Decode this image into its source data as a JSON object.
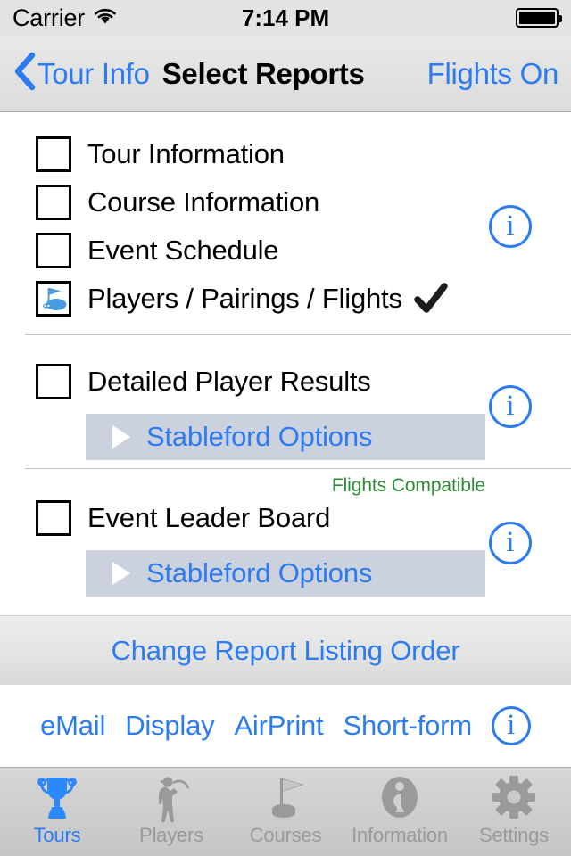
{
  "status_bar": {
    "carrier": "Carrier",
    "wifi_icon": "wifi-icon",
    "time": "7:14 PM",
    "battery_icon": "battery-full-icon"
  },
  "nav_bar": {
    "back_icon": "chevron-left-icon",
    "back_label": "Tour Info",
    "title": "Select Reports",
    "right_action": "Flights On"
  },
  "colors": {
    "accent_blue": "#2b7bf3",
    "compat_green": "#2d8b33",
    "stableford_bg": "#ccd1de",
    "tab_inactive": "#9a9a9a"
  },
  "reports": {
    "group_one": [
      {
        "label": "Tour Information",
        "checked": false,
        "icon": "empty-checkbox-icon"
      },
      {
        "label": "Course Information",
        "checked": false,
        "icon": "empty-checkbox-icon"
      },
      {
        "label": "Event Schedule",
        "checked": false,
        "icon": "empty-checkbox-icon"
      },
      {
        "label": "Players / Pairings / Flights",
        "checked": true,
        "icon": "golf-green-flag-icon",
        "trailing_mark": "✓"
      }
    ],
    "group_two": {
      "label": "Detailed Player Results",
      "checked": false,
      "sub_action": "Stableford Options",
      "sub_action_icon": "triangle-right-icon"
    },
    "group_three": {
      "badge": "Flights Compatible",
      "label": "Event Leader Board",
      "checked": false,
      "sub_action": "Stableford Options",
      "sub_action_icon": "triangle-right-icon"
    },
    "info_icon_glyph": "i"
  },
  "order_band": {
    "label": "Change Report Listing Order"
  },
  "action_bar": {
    "items": [
      "eMail",
      "Display",
      "AirPrint",
      "Short-form"
    ],
    "info_icon_glyph": "i"
  },
  "tab_bar": {
    "items": [
      {
        "label": "Tours",
        "icon": "trophy-icon",
        "active": true
      },
      {
        "label": "Players",
        "icon": "golfer-swing-icon",
        "active": false
      },
      {
        "label": "Courses",
        "icon": "golf-flag-icon",
        "active": false
      },
      {
        "label": "Information",
        "icon": "info-circle-icon",
        "active": false
      },
      {
        "label": "Settings",
        "icon": "gear-icon",
        "active": false
      }
    ]
  }
}
